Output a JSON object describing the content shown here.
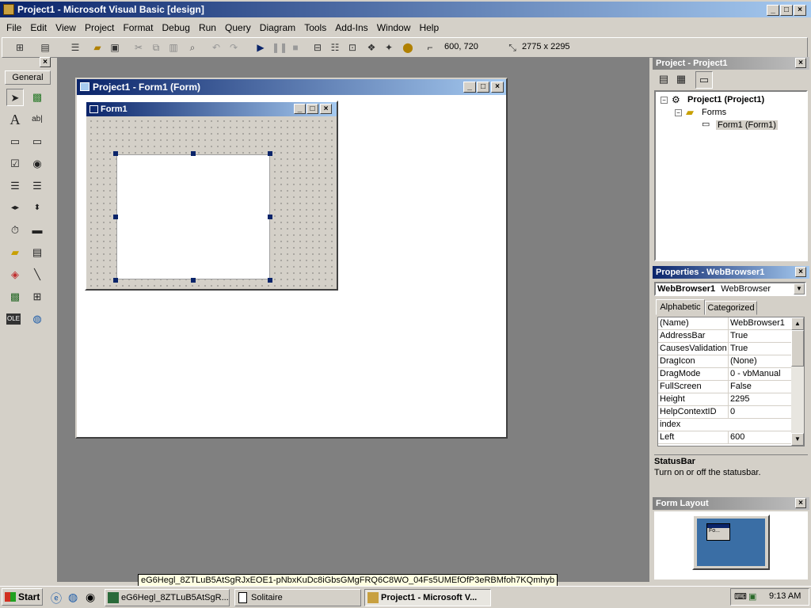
{
  "app": {
    "title": "Project1 - Microsoft Visual Basic [design]"
  },
  "menu": [
    "File",
    "Edit",
    "View",
    "Project",
    "Format",
    "Debug",
    "Run",
    "Query",
    "Diagram",
    "Tools",
    "Add-Ins",
    "Window",
    "Help"
  ],
  "toolbar": {
    "position": "600, 720",
    "size": "2775 x 2295"
  },
  "toolbox": {
    "tab": "General"
  },
  "form_designer": {
    "title": "Project1 - Form1 (Form)",
    "form_caption": "Form1"
  },
  "project_explorer": {
    "title": "Project - Project1",
    "root": "Project1 (Project1)",
    "folder": "Forms",
    "item": "Form1 (Form1)"
  },
  "properties": {
    "title": "Properties - WebBrowser1",
    "object_name": "WebBrowser1",
    "object_type": "WebBrowser",
    "tab_alphabetic": "Alphabetic",
    "tab_categorized": "Categorized",
    "rows": [
      {
        "name": "(Name)",
        "value": "WebBrowser1"
      },
      {
        "name": "AddressBar",
        "value": "True"
      },
      {
        "name": "CausesValidation",
        "value": "True"
      },
      {
        "name": "DragIcon",
        "value": "(None)"
      },
      {
        "name": "DragMode",
        "value": "0 - vbManual"
      },
      {
        "name": "FullScreen",
        "value": "False"
      },
      {
        "name": "Height",
        "value": "2295"
      },
      {
        "name": "HelpContextID",
        "value": "0"
      },
      {
        "name": "index",
        "value": ""
      },
      {
        "name": "Left",
        "value": "600"
      }
    ],
    "desc_title": "StatusBar",
    "desc_text": "Turn on or off the statusbar."
  },
  "form_layout": {
    "title": "Form Layout",
    "thumb_caption": "Fo..."
  },
  "tooltip": "eG6Hegl_8ZTLuB5AtSgRJxEOE1-pNbxKuDc8iGbsGMgFRQ6C8WO_04Fs5UMEfOfP3eRBMfoh7KQmhyb",
  "taskbar": {
    "start": "Start",
    "tasks": [
      "eG6Hegl_8ZTLuB5AtSgR...",
      "Solitaire",
      "Project1 - Microsoft V..."
    ],
    "clock": "9:13 AM"
  }
}
